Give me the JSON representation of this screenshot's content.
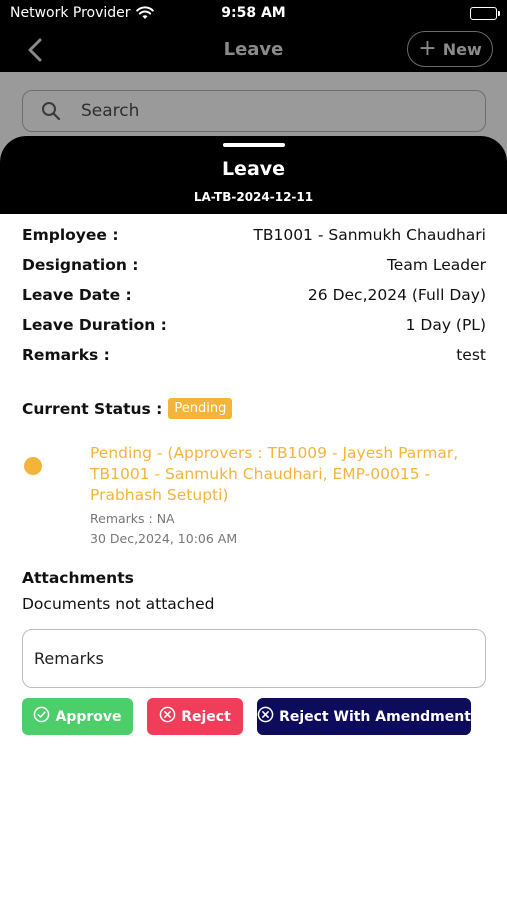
{
  "status_bar": {
    "carrier": "Network Provider",
    "time": "9:58 AM"
  },
  "nav": {
    "title": "Leave",
    "new_label": "New"
  },
  "search": {
    "placeholder": "Search"
  },
  "sheet": {
    "title": "Leave",
    "subtitle": "LA-TB-2024-12-11",
    "details": [
      {
        "label": "Employee :",
        "value": "TB1001 - Sanmukh Chaudhari"
      },
      {
        "label": "Designation :",
        "value": "Team Leader"
      },
      {
        "label": "Leave Date :",
        "value": "26 Dec,2024 (Full Day)"
      },
      {
        "label": "Leave Duration :",
        "value": "1 Day (PL)"
      },
      {
        "label": "Remarks :",
        "value": "test"
      }
    ],
    "current_status_label": "Current Status :",
    "status_badge": "Pending",
    "timeline": {
      "text": "Pending - (Approvers : TB1009 - Jayesh Parmar, TB1001 - Sanmukh Chaudhari, EMP-00015 - Prabhash Setupti)",
      "remarks": "Remarks : NA",
      "time": "30 Dec,2024, 10:06 AM"
    },
    "attachments_title": "Attachments",
    "attachments_text": "Documents not attached",
    "remarks_placeholder": "Remarks",
    "buttons": {
      "approve": "Approve",
      "reject": "Reject",
      "reject_amend": "Reject With Amendment"
    }
  },
  "colors": {
    "pending": "#f4b43a",
    "approve": "#4ccf6a",
    "reject": "#ef3d5a",
    "amend": "#0d0b5c",
    "header": "#000000"
  }
}
